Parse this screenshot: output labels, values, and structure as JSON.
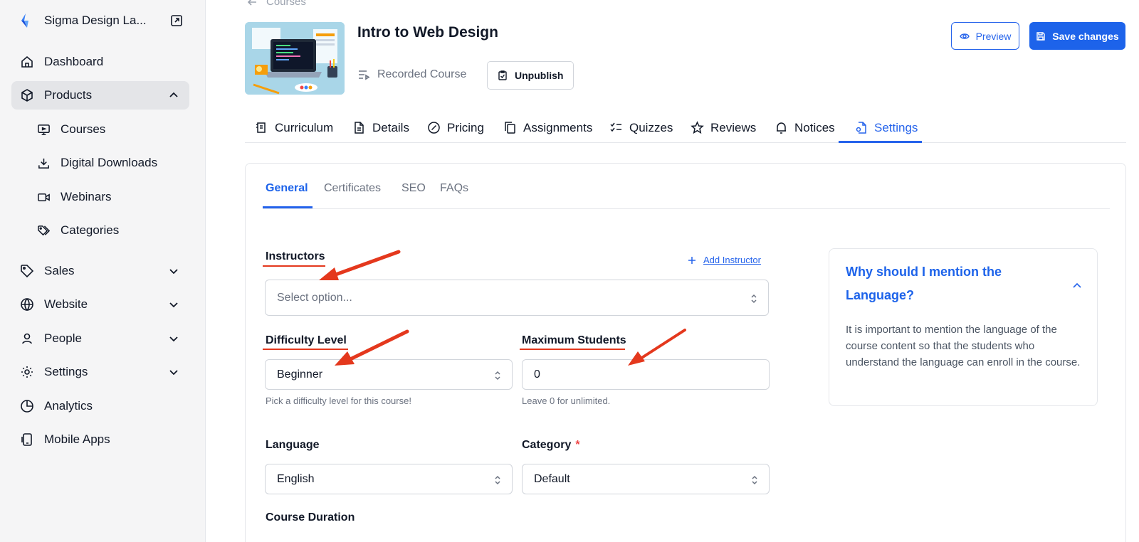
{
  "sidebar": {
    "brand": "Sigma Design La...",
    "items": [
      {
        "label": "Dashboard"
      },
      {
        "label": "Products"
      },
      {
        "label": "Sales"
      },
      {
        "label": "Website"
      },
      {
        "label": "People"
      },
      {
        "label": "Settings"
      },
      {
        "label": "Analytics"
      },
      {
        "label": "Mobile Apps"
      }
    ],
    "subitems": [
      {
        "label": "Courses"
      },
      {
        "label": "Digital Downloads"
      },
      {
        "label": "Webinars"
      },
      {
        "label": "Categories"
      }
    ]
  },
  "header": {
    "back_label": "Courses",
    "course_title": "Intro to Web Design",
    "course_type": "Recorded Course",
    "unpublish_label": "Unpublish",
    "preview_label": "Preview",
    "save_label": "Save changes"
  },
  "tabs": [
    {
      "label": "Curriculum"
    },
    {
      "label": "Details"
    },
    {
      "label": "Pricing"
    },
    {
      "label": "Assignments"
    },
    {
      "label": "Quizzes"
    },
    {
      "label": "Reviews"
    },
    {
      "label": "Notices"
    },
    {
      "label": "Settings"
    }
  ],
  "active_tab": "Settings",
  "subtabs": [
    {
      "label": "General"
    },
    {
      "label": "Certificates"
    },
    {
      "label": "SEO"
    },
    {
      "label": "FAQs"
    }
  ],
  "active_subtab": "General",
  "form": {
    "instructors": {
      "label": "Instructors",
      "placeholder": "Select option...",
      "add_label": "Add Instructor"
    },
    "difficulty": {
      "label": "Difficulty Level",
      "value": "Beginner",
      "hint": "Pick a difficulty level for this course!"
    },
    "max_students": {
      "label": "Maximum Students",
      "value": "0",
      "hint": "Leave 0 for unlimited."
    },
    "language": {
      "label": "Language",
      "value": "English"
    },
    "category": {
      "label": "Category",
      "required_mark": "*",
      "value": "Default"
    },
    "duration": {
      "label": "Course Duration"
    }
  },
  "help": {
    "title": "Why should I mention the Language?",
    "body": "It is important to mention the language of the course content so that the students who understand the language can enroll in the course."
  },
  "colors": {
    "accent": "#2563eb",
    "annotation": "#e4381d",
    "sidebar_bg": "#f5f5f6"
  }
}
